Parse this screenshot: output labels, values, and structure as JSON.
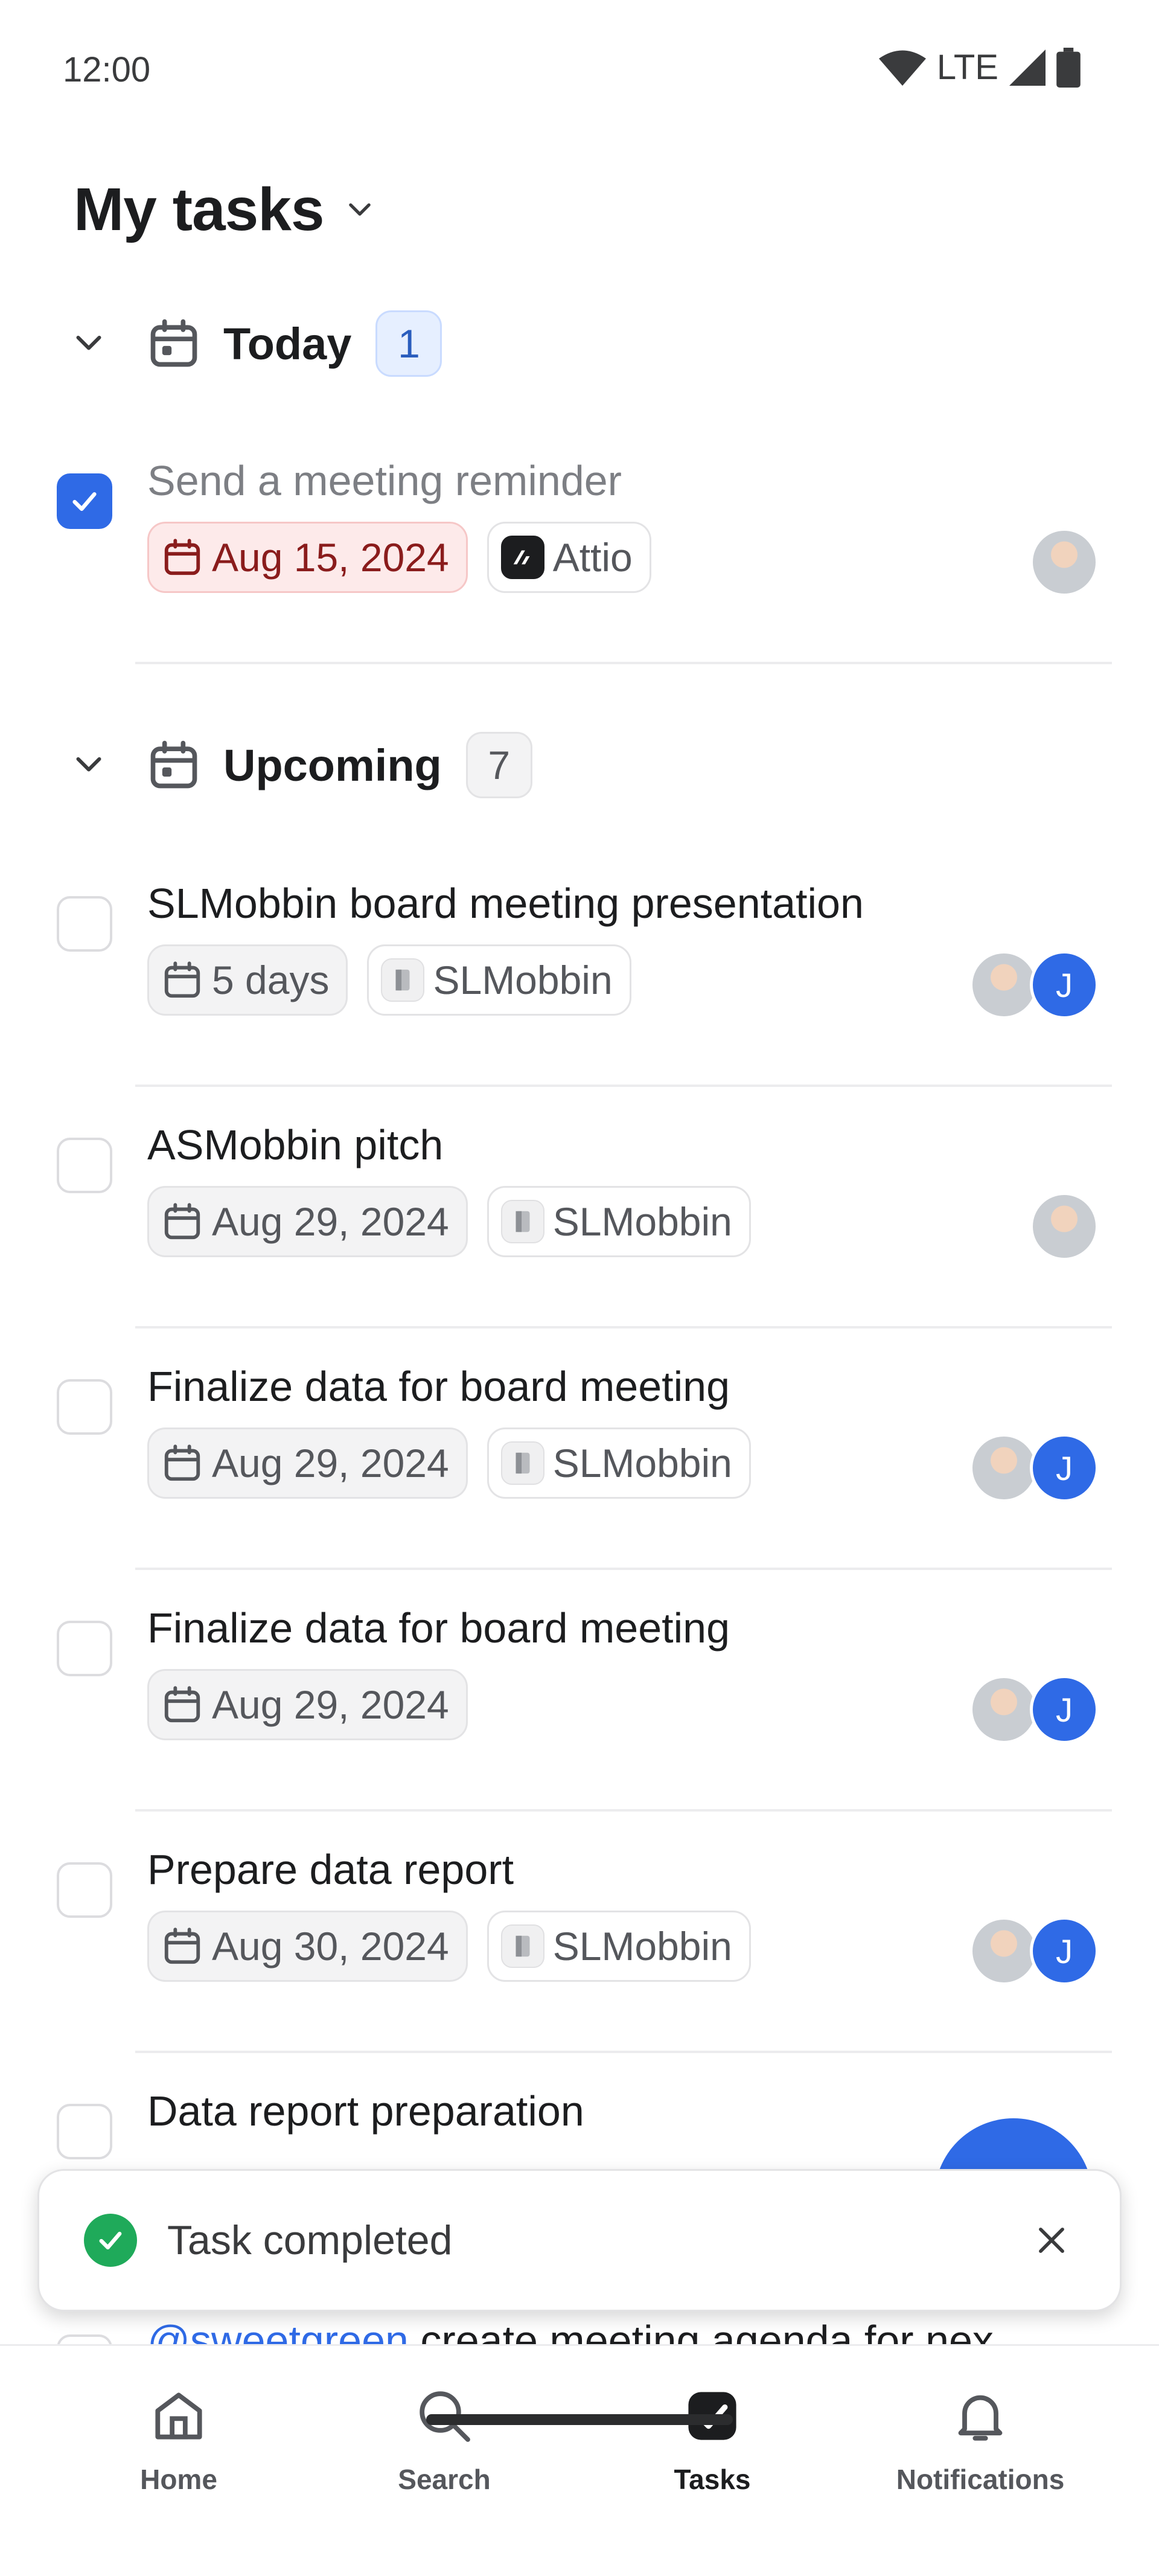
{
  "status_bar": {
    "time": "12:00",
    "network": "LTE"
  },
  "header": {
    "title": "My tasks"
  },
  "sections": {
    "today": {
      "label": "Today",
      "count": "1"
    },
    "upcoming": {
      "label": "Upcoming",
      "count": "7"
    }
  },
  "tasks": [
    {
      "title": "Send a meeting reminder",
      "completed": true,
      "due": "Aug 15, 2024",
      "due_status": "overdue",
      "company": "Attio",
      "assignees": [
        "photo"
      ]
    },
    {
      "title": "SLMobbin board meeting presentation",
      "completed": false,
      "due": "5 days",
      "company": "SLMobbin",
      "assignees": [
        "photo",
        "J"
      ]
    },
    {
      "title": "ASMobbin pitch",
      "completed": false,
      "due": "Aug 29, 2024",
      "company": "SLMobbin",
      "assignees": [
        "photo"
      ]
    },
    {
      "title": "Finalize data for board meeting",
      "completed": false,
      "due": "Aug 29, 2024",
      "company": "SLMobbin",
      "assignees": [
        "photo",
        "J"
      ]
    },
    {
      "title": "Finalize data for board meeting",
      "completed": false,
      "due": "Aug 29, 2024",
      "company": "",
      "assignees": [
        "photo",
        "J"
      ]
    },
    {
      "title": "Prepare data report",
      "completed": false,
      "due": "Aug 30, 2024",
      "company": "SLMobbin",
      "assignees": [
        "photo",
        "J"
      ]
    },
    {
      "title": "Data report preparation",
      "completed": false
    }
  ],
  "peek_task": {
    "mention": "@sweetgreen",
    "text": " create meeting agenda for nex"
  },
  "toast": {
    "message": "Task completed"
  },
  "bottom_nav": [
    {
      "label": "Home",
      "icon": "home-icon"
    },
    {
      "label": "Search",
      "icon": "search-icon"
    },
    {
      "label": "Tasks",
      "icon": "tasks-icon",
      "active": true
    },
    {
      "label": "Notifications",
      "icon": "bell-icon"
    }
  ],
  "colors": {
    "accent": "#2f6ae6",
    "overdue_bg": "#fdeaea",
    "success": "#1faa5a"
  }
}
